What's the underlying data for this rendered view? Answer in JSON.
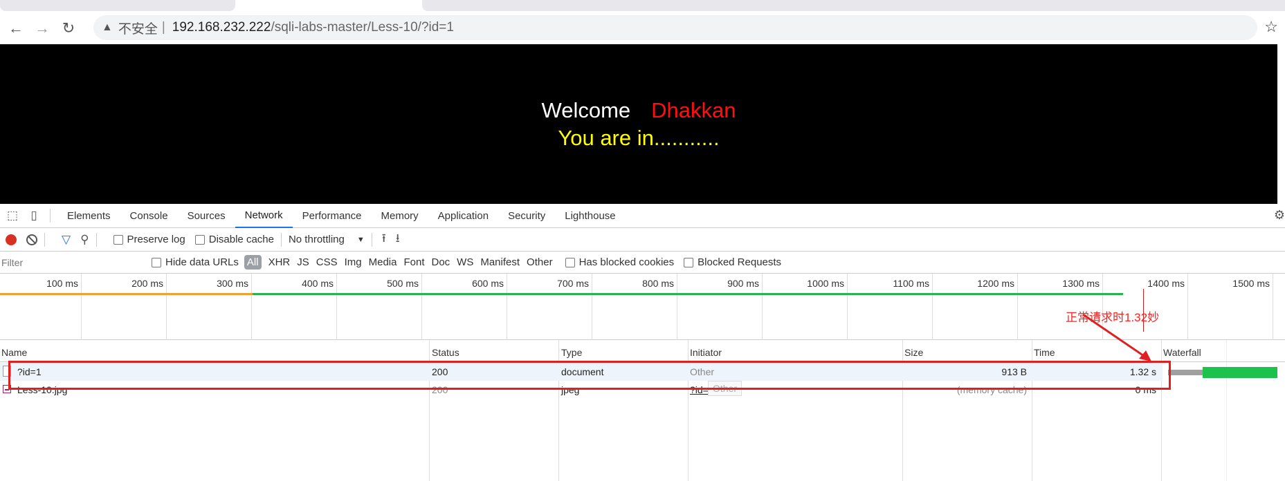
{
  "browser": {
    "insecure_label": "不安全",
    "separator": "|",
    "url_host": "192.168.232.222",
    "url_path": "/sqli-labs-master/Less-10/?id=1"
  },
  "page": {
    "welcome": "Welcome",
    "name": "Dhakkan",
    "message": "You are in..........."
  },
  "devtools": {
    "tabs": [
      "Elements",
      "Console",
      "Sources",
      "Network",
      "Performance",
      "Memory",
      "Application",
      "Security",
      "Lighthouse"
    ],
    "active_tab": "Network",
    "toolbar": {
      "preserve_log": "Preserve log",
      "disable_cache": "Disable cache",
      "throttling": "No throttling"
    },
    "filter": {
      "placeholder": "Filter",
      "hide_data_urls": "Hide data URLs",
      "types": [
        "All",
        "XHR",
        "JS",
        "CSS",
        "Img",
        "Media",
        "Font",
        "Doc",
        "WS",
        "Manifest",
        "Other"
      ],
      "has_blocked_cookies": "Has blocked cookies",
      "blocked_requests": "Blocked Requests"
    },
    "timeline_ticks": [
      "100 ms",
      "200 ms",
      "300 ms",
      "400 ms",
      "500 ms",
      "600 ms",
      "700 ms",
      "800 ms",
      "900 ms",
      "1000 ms",
      "1100 ms",
      "1200 ms",
      "1300 ms",
      "1400 ms",
      "1500 ms"
    ],
    "annotation": "正常请求时1.32妙",
    "columns": [
      "Name",
      "Status",
      "Type",
      "Initiator",
      "Size",
      "Time",
      "Waterfall"
    ],
    "rows": [
      {
        "name": "?id=1",
        "status": "200",
        "type": "document",
        "initiator": "Other",
        "size": "913 B",
        "time": "1.32 s"
      },
      {
        "name": "Less-10.jpg",
        "status": "200",
        "type": "jpeg",
        "initiator": "?id=1",
        "size": "(memory cache)",
        "time": "0 ms"
      }
    ],
    "tooltip": "Other",
    "colors": {
      "accent": "#1a73e8",
      "record": "#d93025",
      "annotation": "#ff2020",
      "waterfall": "#1cc24c"
    }
  }
}
